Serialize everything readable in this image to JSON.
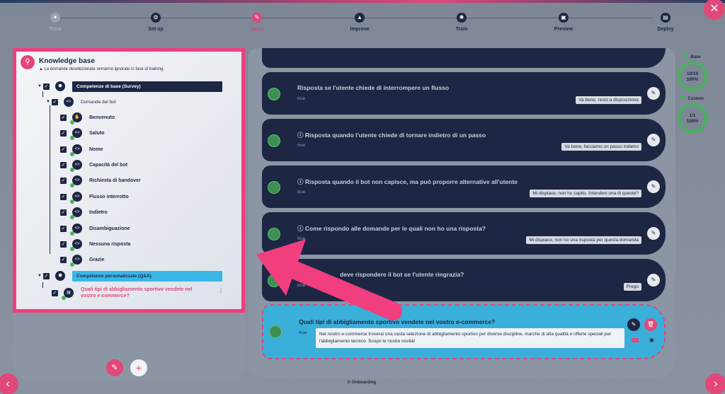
{
  "stepper": {
    "steps": [
      {
        "label": "Think",
        "state": "done",
        "icon": "lightbulb-icon"
      },
      {
        "label": "Set up",
        "state": "normal",
        "icon": "gear-icon"
      },
      {
        "label": "Teach",
        "state": "active",
        "icon": "pencil-icon"
      },
      {
        "label": "Improve",
        "state": "normal",
        "icon": "arrow-up-icon"
      },
      {
        "label": "Train",
        "state": "normal",
        "icon": "brain-icon"
      },
      {
        "label": "Preview",
        "state": "normal",
        "icon": "preview-icon"
      },
      {
        "label": "Deploy",
        "state": "normal",
        "icon": "rocket-icon"
      }
    ]
  },
  "knowledge_base": {
    "title": "Knowledge base",
    "warning": "Le domande deselezionate verranno ignorate in fase di training.",
    "category_base": "Competenze di base (Survey)",
    "group_bot": "Domande del bot",
    "items": [
      "Benvenuto",
      "Saluto",
      "Nome",
      "Capacità del bot",
      "Richiesta di handover",
      "Flusso interrotto",
      "Indietro",
      "Disambiguazione",
      "Nessuna risposta",
      "Grazie"
    ],
    "category_custom": "Competenze personalizzate (Q&A)",
    "custom_item": "Quali tipi di abbigliamento sportivo vendete nel vostro e-commerce?"
  },
  "cards": [
    {
      "question": "Risposta se l'utente chiede di interrompere un flusso",
      "value": "true",
      "answer": "Va bene, resto a disposizione",
      "info": false
    },
    {
      "question": "Risposta quando l'utente chiede di tornare indietro di un passo",
      "value": "true",
      "answer": "Va bene, facciamo un passo indietro",
      "info": true
    },
    {
      "question": "Risposta quando il bot non capisce, ma può proporre alternative all'utente",
      "value": "true",
      "answer": "Mi dispiace, non ho capito. Intendevi una di queste?",
      "info": true
    },
    {
      "question": "Come rispondo alle domande per le quali non ho una risposta?",
      "value": "true",
      "answer": "Mi dispiace, non ho una risposta per questa domanda",
      "info": true
    },
    {
      "question": "deve rispondere il bot se l'utente ringrazia?",
      "value": "true",
      "answer": "Prego",
      "info": false
    }
  ],
  "selected_card": {
    "question": "Quali tipi di abbigliamento sportivo vendete nel vostro e-commerce?",
    "value": "true",
    "answer": "Nel nostro e-commerce troverai una vasta selezione di abbigliamento sportivo per diverse discipline, marche di alta qualità e offerte speciali per l'abbigliamento tecnico. Scopri le nostre novità!"
  },
  "stats": {
    "base": {
      "label": "Base",
      "count": "10/10",
      "percent": "100%"
    },
    "custom": {
      "label": "Custom",
      "count": "1/1",
      "percent": "100%"
    }
  },
  "footer": {
    "onboarding": "Onboarding"
  },
  "colors": {
    "accent": "#e0487a",
    "navy": "#1d2744",
    "cyan": "#3ab7e6",
    "success": "#46b35b"
  }
}
